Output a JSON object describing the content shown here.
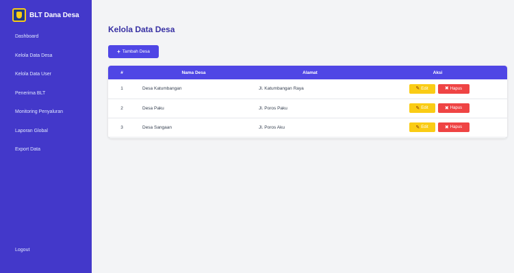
{
  "sidebar": {
    "brand_title": "BLT Dana Desa",
    "items": [
      {
        "label": "Dashboard"
      },
      {
        "label": "Kelola Data Desa"
      },
      {
        "label": "Kelola Data User"
      },
      {
        "label": "Penerima BLT"
      },
      {
        "label": "Monitoring Penyaluran"
      },
      {
        "label": "Laporan Global"
      },
      {
        "label": "Export Data"
      }
    ],
    "logout_label": "Logout",
    "colors": {
      "background": "#4338ca"
    }
  },
  "main": {
    "title": "Kelola Data Desa",
    "add_button_label": "Tambah Desa",
    "table": {
      "headers": {
        "no": "#",
        "name": "Nama Desa",
        "address": "Alamat",
        "actions": "Aksi"
      },
      "rows": [
        {
          "no": "1",
          "name": "Desa Katumbangan",
          "address": "Jl. Katumbangan Raya"
        },
        {
          "no": "2",
          "name": "Desa Paku",
          "address": "Jl. Poros Paku"
        },
        {
          "no": "3",
          "name": "Desa Sangaan",
          "address": "Jl. Poros Aku"
        }
      ],
      "edit_label": "Edit",
      "delete_label": "Hapus"
    },
    "colors": {
      "accent": "#4f46e5",
      "edit": "#facc15",
      "delete": "#ef4444"
    }
  },
  "icons": {
    "edit": "pencil-icon",
    "delete": "trash-icon",
    "add": "plus-icon",
    "logo": "logo-icon"
  }
}
